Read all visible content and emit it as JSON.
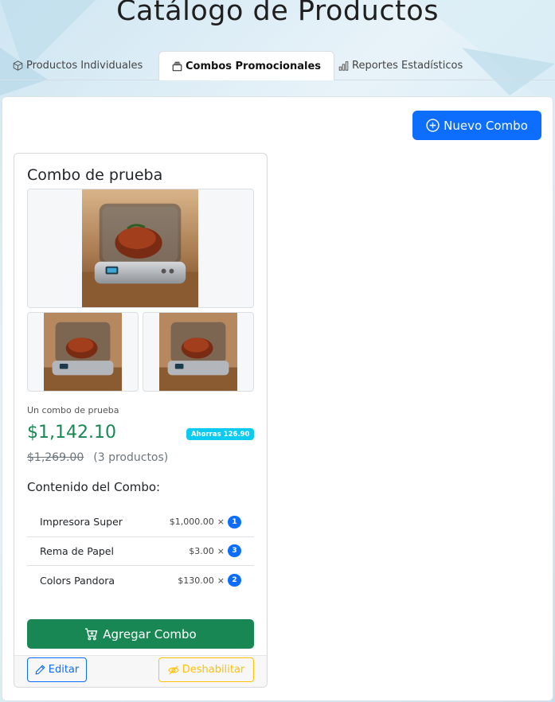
{
  "page": {
    "title": "Catálogo de Productos"
  },
  "tabs": [
    {
      "label": "Productos Individuales",
      "icon": "box-icon",
      "active": false
    },
    {
      "label": "Combos Promocionales",
      "icon": "collection-icon",
      "active": true
    },
    {
      "label": "Reportes Estadísticos",
      "icon": "bar-chart-icon",
      "active": false
    }
  ],
  "actions": {
    "new_combo_label": "Nuevo Combo"
  },
  "combo": {
    "name": "Combo de prueba",
    "description": "Un combo de prueba",
    "price": "$1,142.10",
    "savings": "Ahorras 126.90",
    "original_price": "$1,269.00",
    "product_count": "(3 productos)",
    "contents_title": "Contenido del Combo:",
    "items": [
      {
        "name": "Impresora Super",
        "price": "$1,000.00",
        "times": "×",
        "qty": "1"
      },
      {
        "name": "Rema de Papel",
        "price": "$3.00",
        "times": "×",
        "qty": "3"
      },
      {
        "name": "Colors Pandora",
        "price": "$130.00",
        "times": "×",
        "qty": "2"
      }
    ],
    "add_label": "Agregar Combo",
    "edit_label": "Editar",
    "disable_label": "Deshabilitar"
  },
  "colors": {
    "primary": "#0d6efd",
    "success": "#198754",
    "info": "#0dcaf0",
    "warning": "#ffc107"
  }
}
